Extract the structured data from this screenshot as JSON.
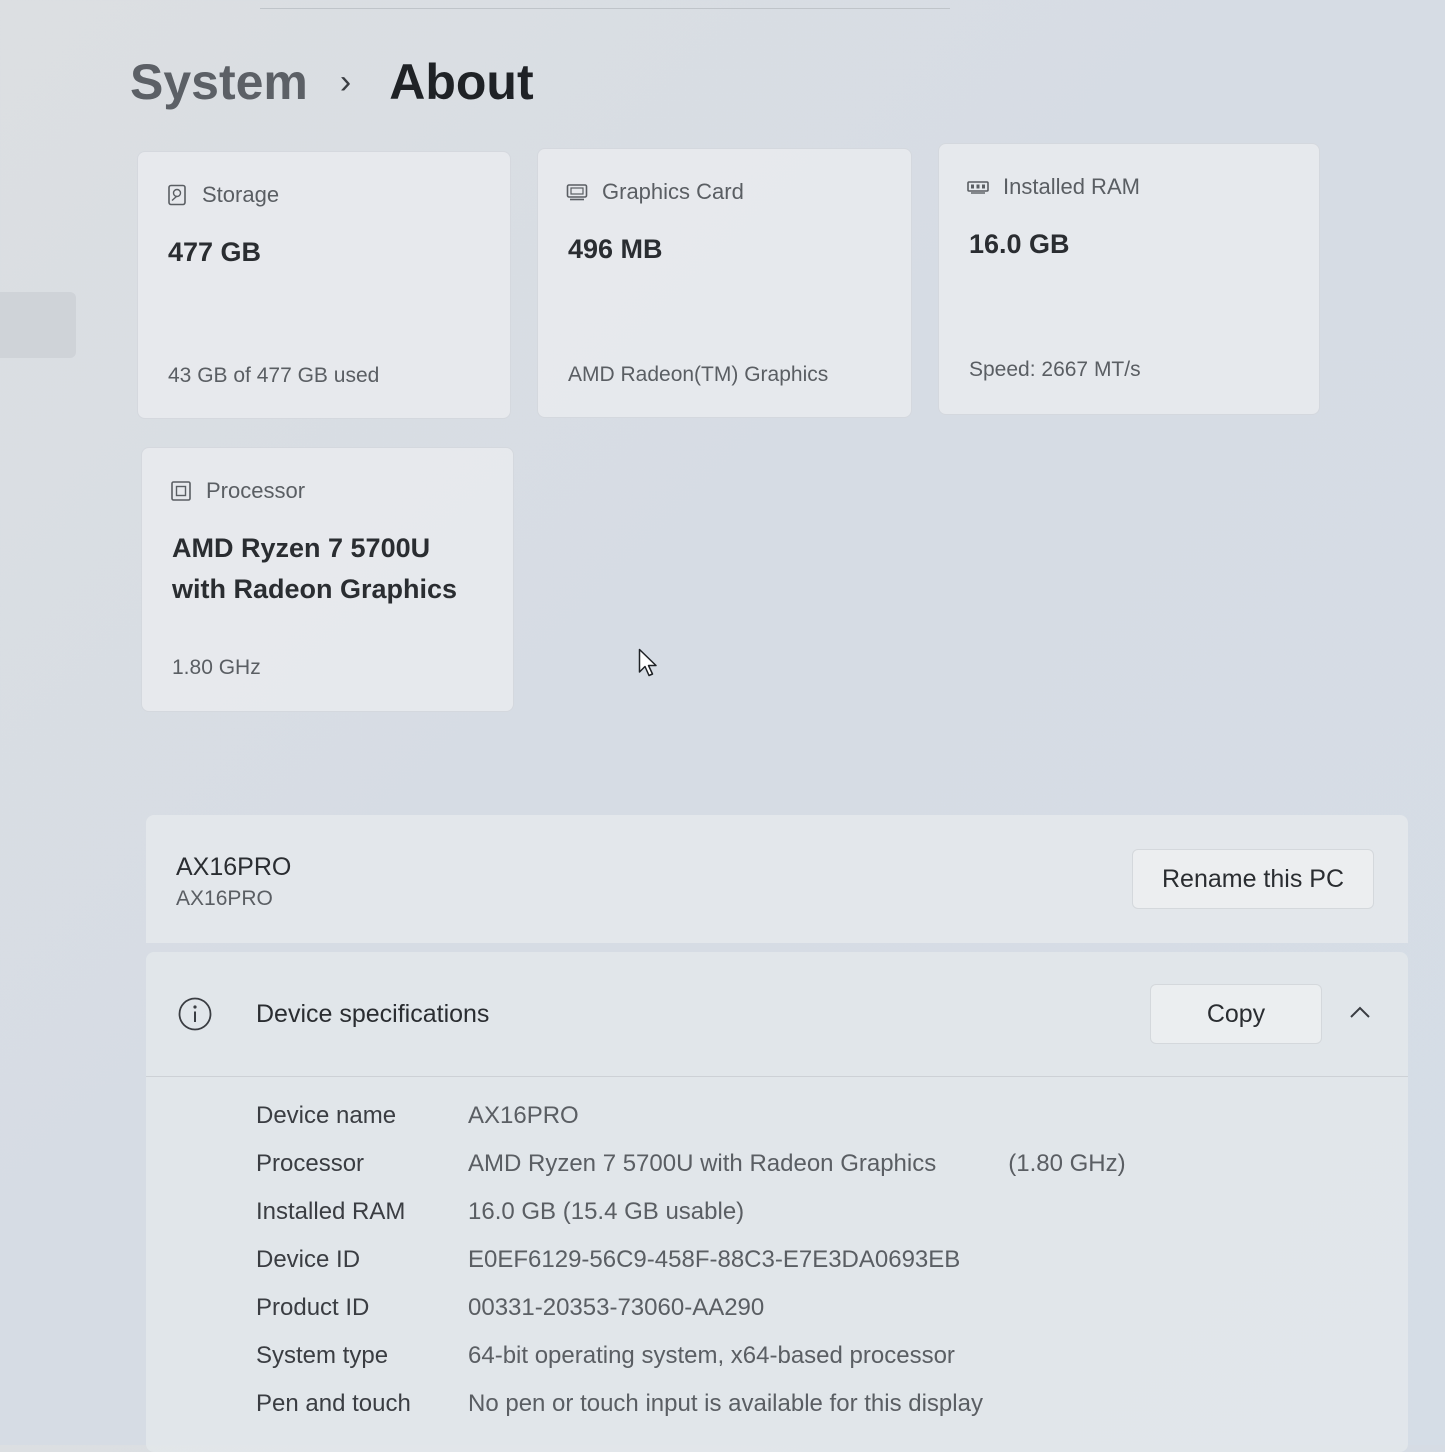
{
  "breadcrumb": {
    "parent": "System",
    "separator": "›",
    "current": "About"
  },
  "cards": {
    "storage": {
      "icon": "storage-icon",
      "title": "Storage",
      "value": "477 GB",
      "sub": "43 GB of 477 GB used"
    },
    "graphics": {
      "icon": "graphics-card-icon",
      "title": "Graphics Card",
      "value": "496 MB",
      "sub": "AMD Radeon(TM) Graphics"
    },
    "ram": {
      "icon": "ram-icon",
      "title": "Installed RAM",
      "value": "16.0 GB",
      "sub": "Speed: 2667 MT/s"
    },
    "processor": {
      "icon": "processor-icon",
      "title": "Processor",
      "value_line1": "AMD Ryzen 7 5700U",
      "value_line2": "with Radeon Graphics",
      "sub": "1.80 GHz"
    }
  },
  "pc": {
    "name": "AX16PRO",
    "name_sub": "AX16PRO",
    "rename_label": "Rename this PC"
  },
  "specs": {
    "icon": "info-icon",
    "title": "Device specifications",
    "copy_label": "Copy",
    "rows": [
      {
        "label": "Device name",
        "value": "AX16PRO"
      },
      {
        "label": "Processor",
        "value": "AMD Ryzen 7 5700U with Radeon Graphics",
        "extra": "(1.80 GHz)"
      },
      {
        "label": "Installed RAM",
        "value": "16.0 GB (15.4 GB usable)"
      },
      {
        "label": "Device ID",
        "value": "E0EF6129-56C9-458F-88C3-E7E3DA0693EB"
      },
      {
        "label": "Product ID",
        "value": "00331-20353-73060-AA290"
      },
      {
        "label": "System type",
        "value": "64-bit operating system, x64-based processor"
      },
      {
        "label": "Pen and touch",
        "value": "No pen or touch input is available for this display"
      }
    ]
  }
}
